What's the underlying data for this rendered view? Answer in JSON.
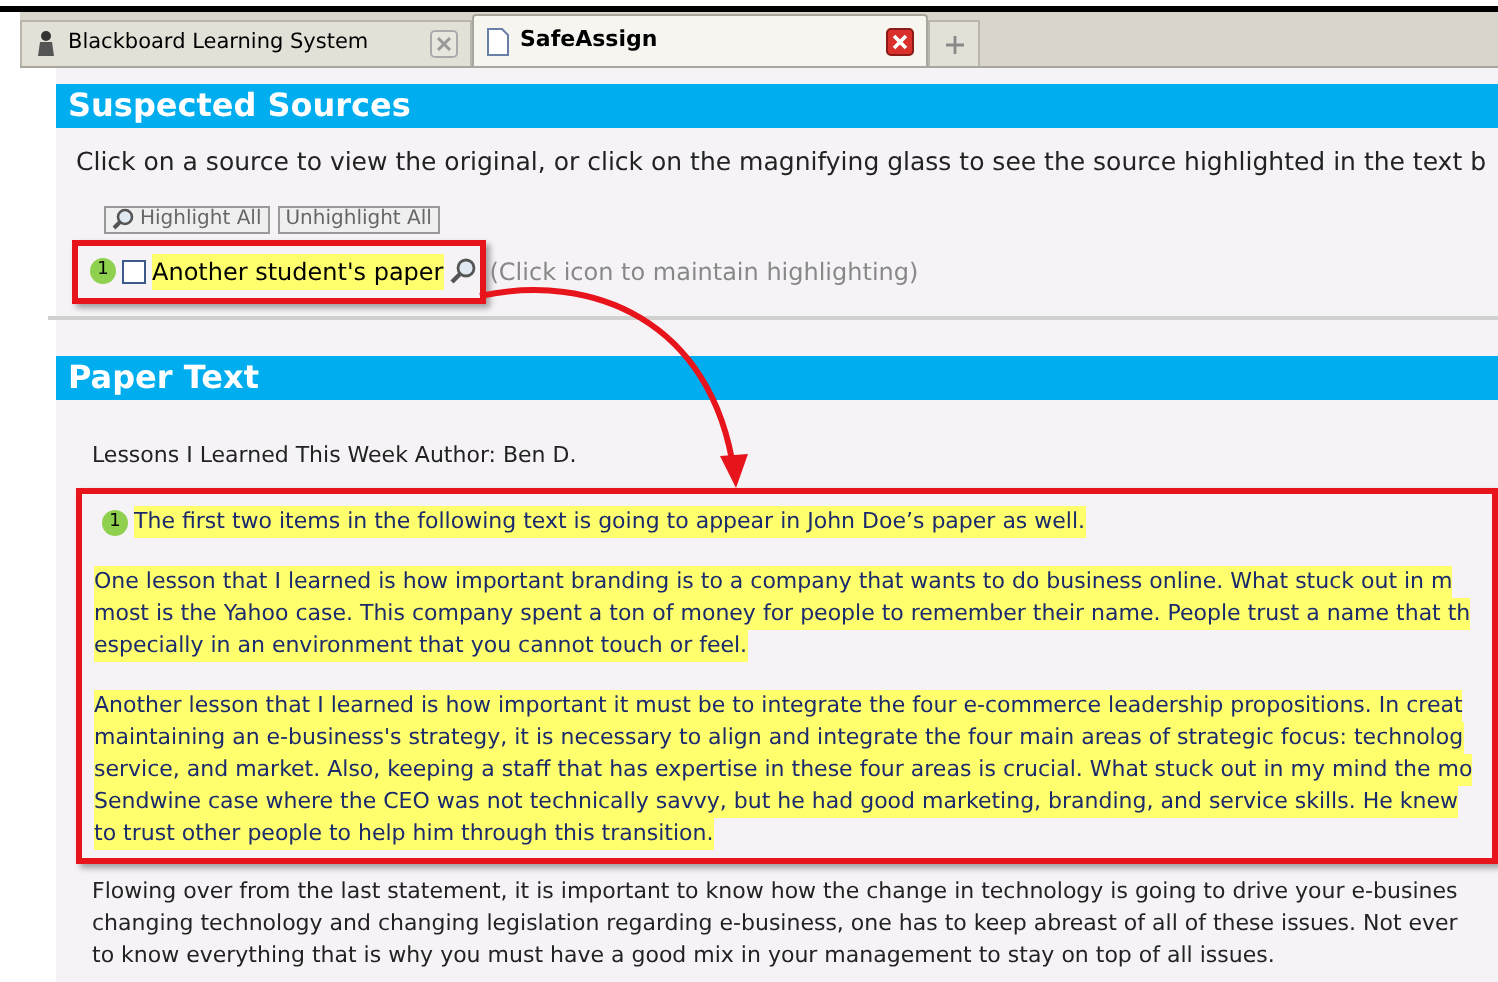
{
  "tabs": [
    {
      "label": "Blackboard Learning System",
      "selected": false
    },
    {
      "label": "SafeAssign",
      "selected": true
    }
  ],
  "suspected_sources": {
    "title": "Suspected Sources",
    "description": "Click on a source to view the original, or click on the magnifying glass to see the source highlighted in the text b",
    "buttons": [
      "Highlight All",
      "Unhighlight All"
    ],
    "sources": [
      {
        "number": "1",
        "checked": false,
        "name": "Another student's paper",
        "hint": "(Click icon to maintain highlighting)"
      }
    ]
  },
  "paper_text": {
    "title": "Paper Text",
    "heading": "Lessons I Learned This Week Author: Ben D.",
    "paragraphs": [
      {
        "highlighted": true,
        "source_number": "1",
        "lines": [
          "The first two items in the following text is going to appear in John Doe’s paper as well."
        ]
      },
      {
        "highlighted": true,
        "lines": [
          "One lesson that I learned is how important branding is to a company that wants to do business online. What stuck out in m",
          "most is the Yahoo case. This company spent a ton of money for people to remember their name. People trust a name that th",
          "especially in an environment that you cannot touch or feel."
        ]
      },
      {
        "highlighted": true,
        "lines": [
          "Another lesson that I learned is how important it must be to integrate the four e-commerce leadership propositions. In creat",
          "maintaining an e-business's strategy, it is necessary to align and integrate the four main areas of strategic focus: technolog",
          "service, and market. Also, keeping a staff that has expertise in these four areas is crucial. What stuck out in my mind the mo",
          "Sendwine case where the CEO was not technically savvy, but he had good marketing, branding, and service skills. He knew",
          "to trust other people to help him through this transition."
        ]
      },
      {
        "highlighted": false,
        "lines": [
          "Flowing over from the last statement, it is important to know how the change in technology is going to drive your e-busines",
          "changing technology and changing legislation regarding e-business, one has to keep abreast of all of these issues. Not ever",
          "to know everything that is why you must have a good mix in your management to stay on top of all issues."
        ]
      }
    ]
  }
}
